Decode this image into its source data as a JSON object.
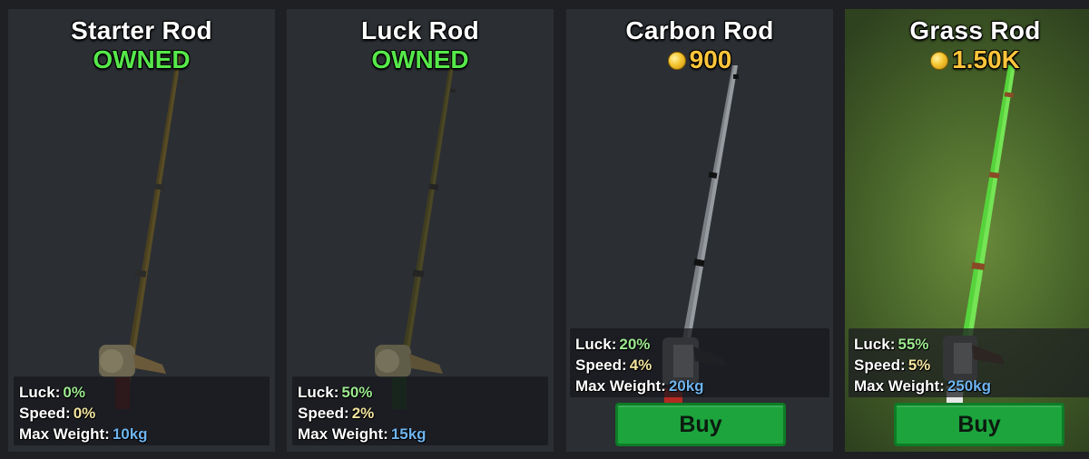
{
  "shop": {
    "cards": [
      {
        "name": "Starter Rod",
        "status": "OWNED",
        "stats": {
          "luck_label": "Luck",
          "luck": "0%",
          "speed_label": "Speed",
          "speed": "0%",
          "weight_label": "Max Weight",
          "weight": "10kg"
        }
      },
      {
        "name": "Luck Rod",
        "status": "OWNED",
        "stats": {
          "luck_label": "Luck",
          "luck": "50%",
          "speed_label": "Speed",
          "speed": "2%",
          "weight_label": "Max Weight",
          "weight": "15kg"
        }
      },
      {
        "name": "Carbon Rod",
        "price": "900",
        "buy_label": "Buy",
        "stats": {
          "luck_label": "Luck",
          "luck": "20%",
          "speed_label": "Speed",
          "speed": "4%",
          "weight_label": "Max Weight",
          "weight": "20kg"
        }
      },
      {
        "name": "Grass Rod",
        "price": "1.50K",
        "buy_label": "Buy",
        "stats": {
          "luck_label": "Luck",
          "luck": "55%",
          "speed_label": "Speed",
          "speed": "5%",
          "weight_label": "Max Weight",
          "weight": "250kg"
        }
      }
    ]
  },
  "colors": {
    "owned": "#56e84a",
    "price": "#ffc53a",
    "buy_button": "#1da43d",
    "luck_value": "#9dea90",
    "speed_value": "#f2e4a0",
    "weight_value": "#6fb4ef"
  },
  "icons": {
    "currency": "coin-icon"
  }
}
